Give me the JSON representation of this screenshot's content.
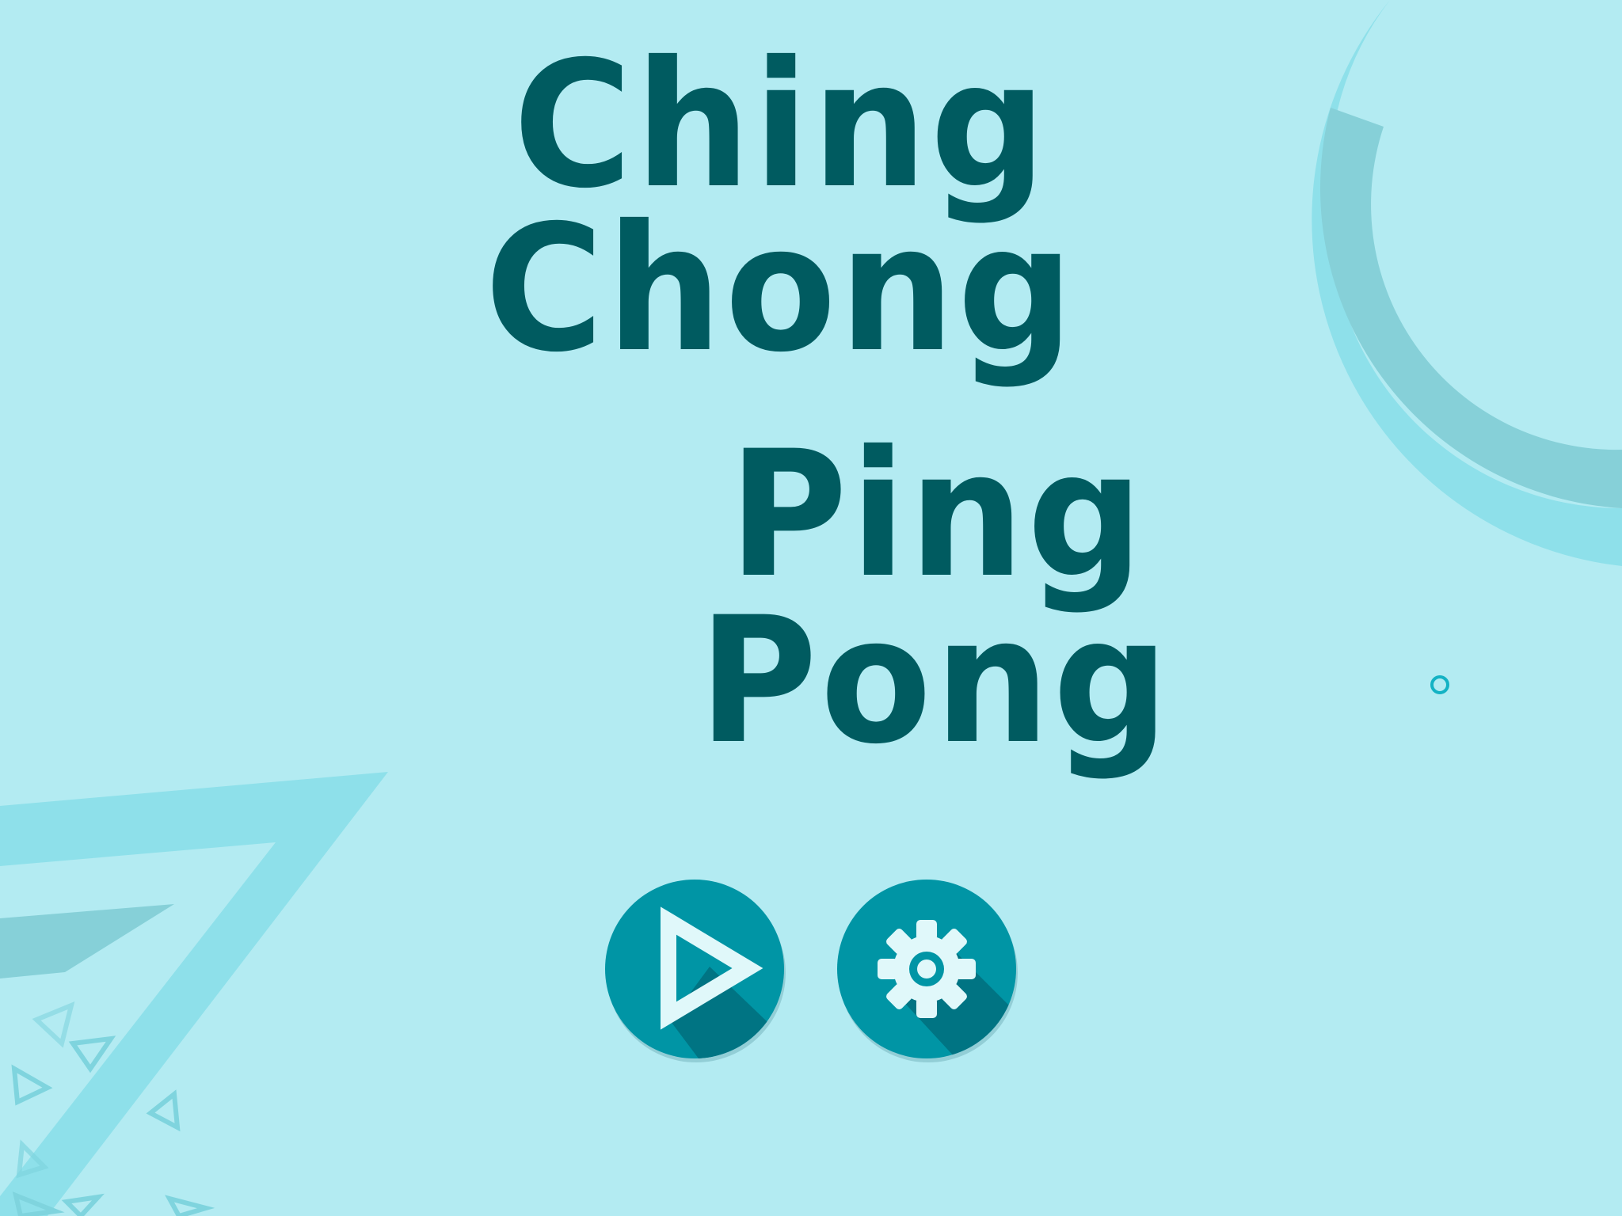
{
  "title": {
    "line1": "Ching",
    "line2": "Chong",
    "line3": "Ping",
    "line4": "Pong"
  },
  "buttons": {
    "play": {
      "icon": "play-icon"
    },
    "settings": {
      "icon": "gear-icon"
    }
  },
  "colors": {
    "background": "#b3ebf2",
    "title": "#005b60",
    "button": "#0095a5",
    "button_shadow": "#007483",
    "icon": "#e0f8fa",
    "deco_light": "#8ee0ea",
    "deco_dark": "#86d0d8"
  }
}
